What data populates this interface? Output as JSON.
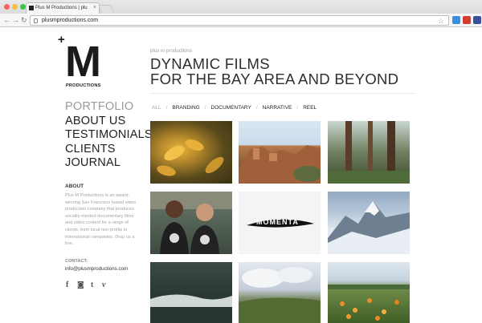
{
  "browser": {
    "tab_title": "Plus M Productions | plu",
    "tab_close": "×",
    "url": "plusmproductions.com",
    "back": "←",
    "forward": "→",
    "reload": "↻",
    "star": "☆"
  },
  "logo": {
    "plus": "+",
    "letter": "M",
    "sub": "PRODUCTIONS"
  },
  "nav": {
    "items": [
      "PORTFOLIO",
      "ABOUT US",
      "TESTIMONIALS",
      "CLIENTS",
      "JOURNAL"
    ]
  },
  "about": {
    "heading": "ABOUT",
    "text": "Plus M Productions is an award-winning San Francisco based video production company that produces socially-minded documentary films and video content for a range of clients, from local non-profits to international companies. Drop us a line."
  },
  "contact": {
    "heading": "CONTACT:",
    "email": "info@plusmproductions.com"
  },
  "social": {
    "facebook": "f",
    "instagram": "◙",
    "tumblr": "t",
    "vimeo": "v"
  },
  "main": {
    "kicker": "plus m productions",
    "headline_1": "DYNAMIC FILMS",
    "headline_2": "FOR THE BAY AREA AND BEYOND"
  },
  "filters": [
    "ALL",
    "BRANDING",
    "DOCUMENTARY",
    "NARRATIVE",
    "REEL"
  ],
  "thumbs": {
    "momenta_label": "MOMENTA"
  },
  "colors": {
    "accent": "#1b1b1b",
    "muted_text": "#a3a3a3",
    "active_nav": "#9a9a9a"
  }
}
